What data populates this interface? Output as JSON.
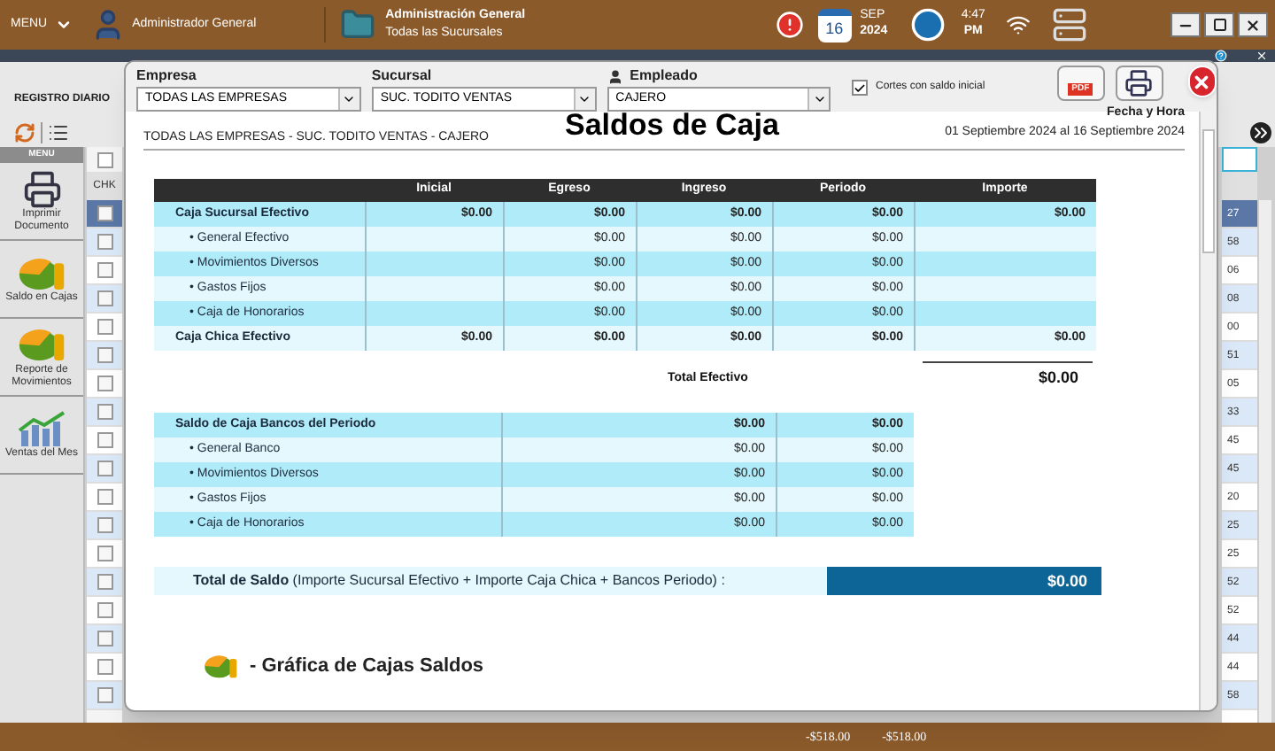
{
  "top_bar": {
    "menu_label": "MENU",
    "user": "Administrador General",
    "company_title": "Administración General",
    "company_subtitle": "Todas las Sucursales",
    "day": "16",
    "month": "SEP",
    "year": "2024",
    "time": "4:47",
    "ampm": "PM"
  },
  "sidebar": {
    "title": "REGISTRO DIARIO",
    "menu_label": "MENU",
    "items": [
      {
        "label": "Imprimir Documento",
        "kind": "printer"
      },
      {
        "label": "Saldo en Cajas",
        "kind": "pie"
      },
      {
        "label": "Reporte de Movimientos",
        "kind": "pie"
      },
      {
        "label": "Ventas del Mes",
        "kind": "chart"
      }
    ]
  },
  "grid": {
    "check_header": "CHK",
    "select_all": {
      "checked": false
    },
    "rows": [
      {
        "selected": true,
        "column_2": "27"
      },
      {
        "selected": false,
        "column_2": "58"
      },
      {
        "selected": false,
        "column_2": "06"
      },
      {
        "selected": false,
        "column_2": "08"
      },
      {
        "selected": false,
        "column_2": "00"
      },
      {
        "selected": false,
        "column_2": "51"
      },
      {
        "selected": false,
        "column_2": "05"
      },
      {
        "selected": false,
        "column_2": "33"
      },
      {
        "selected": false,
        "column_2": "45"
      },
      {
        "selected": false,
        "column_2": "45"
      },
      {
        "selected": false,
        "column_2": "20"
      },
      {
        "selected": false,
        "column_2": "25"
      },
      {
        "selected": false,
        "column_2": "25"
      },
      {
        "selected": false,
        "column_2": "52"
      },
      {
        "selected": false,
        "column_2": "52"
      },
      {
        "selected": false,
        "column_2": "44"
      },
      {
        "selected": false,
        "column_2": "44"
      },
      {
        "selected": false,
        "column_2": "58"
      }
    ]
  },
  "status_bar": {
    "totals": [
      "-$518.00",
      "-$518.00"
    ]
  },
  "dialog": {
    "filters": [
      {
        "label": "Empresa",
        "value": "TODAS LAS EMPRESAS",
        "kind": "plain"
      },
      {
        "label": "Sucursal",
        "value": "SUC. TODITO VENTAS",
        "kind": "plain"
      },
      {
        "label": "Empleado",
        "value": "CAJERO",
        "kind": "person"
      }
    ],
    "option": {
      "label": "Cortes con saldo inicial",
      "checked": true
    },
    "pdf_label": "PDF",
    "report": {
      "title": "Saldos de Caja",
      "subtitle": "TODAS LAS EMPRESAS - SUC. TODITO VENTAS - CAJERO",
      "date_label": "Fecha y Hora",
      "date_range": "01 Septiembre 2024 al 16 Septiembre 2024",
      "cash_table": {
        "columns": [
          "Inicial",
          "Egreso",
          "Ingreso",
          "Periodo",
          "Importe"
        ],
        "rows": [
          {
            "kind": "group",
            "label": "Caja Sucursal Efectivo",
            "cells": [
              "$0.00",
              "$0.00",
              "$0.00",
              "$0.00",
              "$0.00"
            ]
          },
          {
            "kind": "item",
            "label": "• General Efectivo",
            "cells": [
              null,
              "$0.00",
              "$0.00",
              "$0.00",
              null
            ]
          },
          {
            "kind": "item",
            "label": "• Movimientos Diversos",
            "cells": [
              null,
              "$0.00",
              "$0.00",
              "$0.00",
              null
            ]
          },
          {
            "kind": "item",
            "label": "• Gastos Fijos",
            "cells": [
              null,
              "$0.00",
              "$0.00",
              "$0.00",
              null
            ]
          },
          {
            "kind": "item",
            "label": "• Caja de Honorarios",
            "cells": [
              null,
              "$0.00",
              "$0.00",
              "$0.00",
              null
            ]
          },
          {
            "kind": "group",
            "label": "Caja Chica Efectivo",
            "cells": [
              "$0.00",
              "$0.00",
              "$0.00",
              "$0.00",
              "$0.00"
            ]
          }
        ]
      },
      "total_cash": {
        "label": "Total Efectivo",
        "value": "$0.00"
      },
      "bank_table": {
        "rows": [
          {
            "kind": "group",
            "label": "Saldo de Caja Bancos del Periodo",
            "cells": [
              "$0.00",
              "$0.00"
            ]
          },
          {
            "kind": "item",
            "label": "• General Banco",
            "cells": [
              "$0.00",
              "$0.00"
            ]
          },
          {
            "kind": "item",
            "label": "• Movimientos Diversos",
            "cells": [
              "$0.00",
              "$0.00"
            ]
          },
          {
            "kind": "item",
            "label": "• Gastos Fijos",
            "cells": [
              "$0.00",
              "$0.00"
            ]
          },
          {
            "kind": "item",
            "label": "• Caja de Honorarios",
            "cells": [
              "$0.00",
              "$0.00"
            ]
          }
        ]
      },
      "grand_total": {
        "label": "**Total de Saldo** (Importe Sucursal Efectivo + Importe Caja Chica + Bancos Periodo) :",
        "value": "$0.00"
      },
      "chart_heading": "- Gráfica de Cajas Saldos"
    }
  }
}
